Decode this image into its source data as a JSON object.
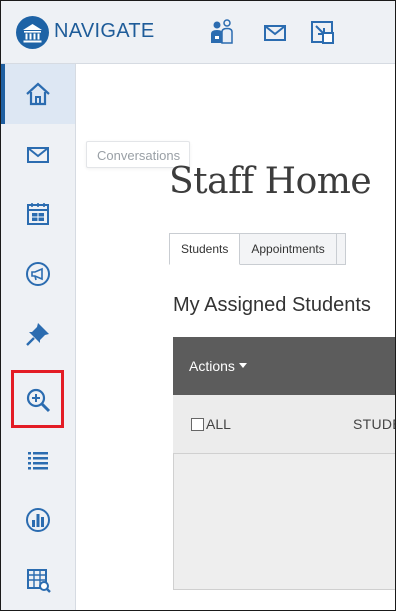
{
  "app": {
    "name": "NAVIGATE",
    "brand_color": "#1e63a6"
  },
  "top_icons": [
    "people-icon",
    "mail-icon",
    "window-arrow-icon"
  ],
  "sidebar": {
    "items": [
      {
        "icon": "home-icon",
        "active": true
      },
      {
        "icon": "mail-icon"
      },
      {
        "icon": "calendar-icon"
      },
      {
        "icon": "megaphone-icon"
      },
      {
        "icon": "pin-icon"
      },
      {
        "icon": "zoom-in-icon",
        "highlighted": true
      },
      {
        "icon": "list-icon"
      },
      {
        "icon": "chart-icon"
      },
      {
        "icon": "report-icon"
      }
    ],
    "highlight_color": "#e31c25"
  },
  "tooltip": "Conversations",
  "page": {
    "title": "Staff Home",
    "tabs": [
      {
        "label": "Students",
        "active": true
      },
      {
        "label": "Appointments"
      }
    ],
    "section_title": "My Assigned Students"
  },
  "table": {
    "actions_label": "Actions",
    "select_all_label": "ALL",
    "column_student": "STUDENT"
  }
}
